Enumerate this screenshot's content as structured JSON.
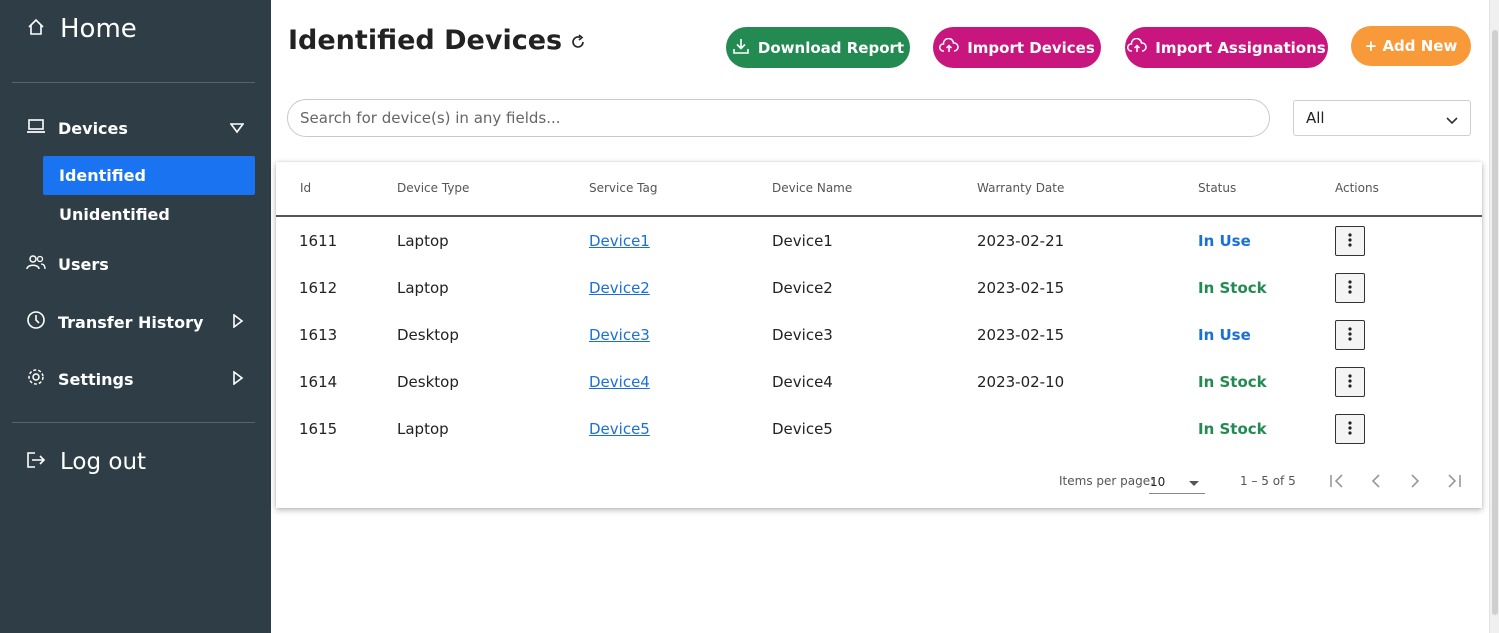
{
  "sidebar": {
    "home_label": "Home",
    "devices_label": "Devices",
    "sub_items": [
      "Identified",
      "Unidentified"
    ],
    "users_label": "Users",
    "transfer_label": "Transfer History",
    "settings_label": "Settings",
    "logout_label": "Log out"
  },
  "header": {
    "title": "Identified Devices",
    "download_label": "Download Report",
    "import_devices_label": "Import Devices",
    "import_assignations_label": "Import Assignations",
    "add_new_label": "+ Add New"
  },
  "search": {
    "placeholder": "Search for device(s) in any fields...",
    "filter_value": "All"
  },
  "table": {
    "headers": {
      "id": "Id",
      "type": "Device Type",
      "tag": "Service Tag",
      "name": "Device Name",
      "warranty": "Warranty Date",
      "status": "Status",
      "actions": "Actions"
    },
    "rows": [
      {
        "id": "1611",
        "type": "Laptop",
        "tag": "Device1",
        "name": "Device1",
        "warranty": "2023-02-21",
        "status": "In Use"
      },
      {
        "id": "1612",
        "type": "Laptop",
        "tag": "Device2",
        "name": "Device2",
        "warranty": "2023-02-15",
        "status": "In Stock"
      },
      {
        "id": "1613",
        "type": "Desktop",
        "tag": "Device3",
        "name": "Device3",
        "warranty": "2023-02-15",
        "status": "In Use"
      },
      {
        "id": "1614",
        "type": "Desktop",
        "tag": "Device4",
        "name": "Device4",
        "warranty": "2023-02-10",
        "status": "In Stock"
      },
      {
        "id": "1615",
        "type": "Laptop",
        "tag": "Device5",
        "name": "Device5",
        "warranty": "",
        "status": "In Stock"
      }
    ]
  },
  "paginator": {
    "items_per_page_label": "Items per page:",
    "items_per_page": "10",
    "range": "1 – 5 of 5"
  },
  "colors": {
    "sidebar_bg": "#2f3e46",
    "active_item": "#1a73f0",
    "download_green": "#238a52",
    "import_magenta": "#c9167e",
    "add_orange": "#f99a3a",
    "status_in_use": "#1a6fd8",
    "status_in_stock": "#238a52"
  },
  "icons": [
    "home-icon",
    "laptop-icon",
    "users-icon",
    "clock-icon",
    "gear-icon",
    "logout-icon",
    "refresh-icon",
    "download-icon",
    "cloud-upload-icon",
    "kebab-icon"
  ]
}
